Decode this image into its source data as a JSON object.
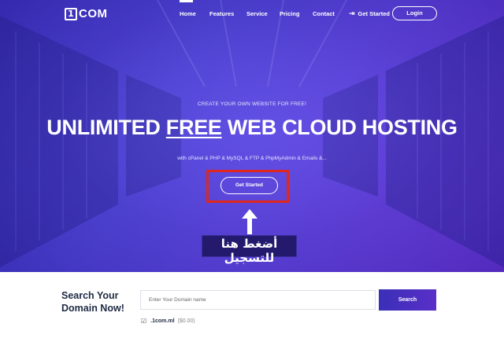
{
  "nav": {
    "logo_mark": "1",
    "logo_text": "COM",
    "links": [
      "Home",
      "Features",
      "Service",
      "Pricing",
      "Contact"
    ],
    "get_started": "Get Started",
    "login": "Login"
  },
  "hero": {
    "subtitle": "CREATE YOUR OWN WEBSITE FOR FREE!",
    "headline_pre": "UNLIMITED ",
    "headline_free": "FREE",
    "headline_post": " WEB CLOUD HOSTING",
    "features": "with cPanel & PHP & MySQL & FTP & PhpMyAdmin & Emails &...",
    "cta": "Get Started",
    "annotation": "أضغط هنا للتسجيل"
  },
  "domain_search": {
    "title_line1": "Search Your",
    "title_line2": "Domain Now!",
    "placeholder": "Enter Your Domain name",
    "button": "Search",
    "tld": ".1com.ml",
    "tld_price": "($0.00)"
  },
  "colors": {
    "hero_start": "#3a2fb8",
    "hero_end": "#6a2fd0",
    "highlight": "#e0261d",
    "annotation_bg": "#231a6e"
  }
}
